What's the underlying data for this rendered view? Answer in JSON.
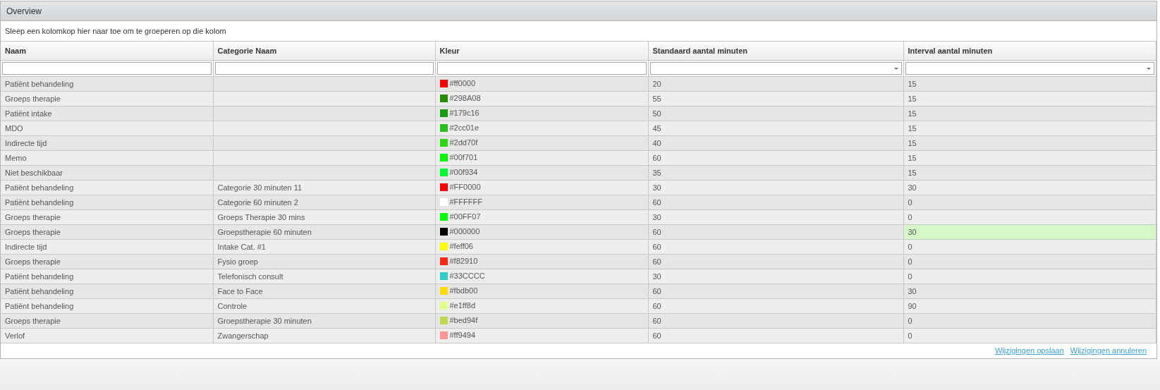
{
  "panel": {
    "title": "Overview"
  },
  "group_hint": "Sleep een kolomkop hier naar toe om te groeperen op die kolom",
  "table": {
    "columns": [
      {
        "label": "Naam",
        "kind": "text"
      },
      {
        "label": "Categorie Naam",
        "kind": "text"
      },
      {
        "label": "Kleur",
        "kind": "text"
      },
      {
        "label": "Standaard aantal minuten",
        "kind": "dropdown"
      },
      {
        "label": "Interval aantal minuten",
        "kind": "dropdown"
      }
    ],
    "rows": [
      {
        "name": "Patiënt behandeling",
        "category": "",
        "color": "#ff0000",
        "color_text": "#ff0000",
        "standard": "20",
        "interval": "15",
        "interval_changed": false
      },
      {
        "name": "Groeps therapie",
        "category": "",
        "color": "#298a08",
        "color_text": "#298A08",
        "standard": "55",
        "interval": "15",
        "interval_changed": false
      },
      {
        "name": "Patiënt intake",
        "category": "",
        "color": "#179c16",
        "color_text": "#179c16",
        "standard": "50",
        "interval": "15",
        "interval_changed": false
      },
      {
        "name": "MDO",
        "category": "",
        "color": "#2cc01e",
        "color_text": "#2cc01e",
        "standard": "45",
        "interval": "15",
        "interval_changed": false
      },
      {
        "name": "Indirecte tijd",
        "category": "",
        "color": "#2dd70f",
        "color_text": "#2dd70f",
        "standard": "40",
        "interval": "15",
        "interval_changed": false
      },
      {
        "name": "Memo",
        "category": "",
        "color": "#00f701",
        "color_text": "#00f701",
        "standard": "60",
        "interval": "15",
        "interval_changed": false
      },
      {
        "name": "Niet beschikbaar",
        "category": "",
        "color": "#00f934",
        "color_text": "#00f934",
        "standard": "35",
        "interval": "15",
        "interval_changed": false
      },
      {
        "name": "Patiënt behandeling",
        "category": "Categorie 30 minuten 11",
        "color": "#ff0000",
        "color_text": "#FF0000",
        "standard": "30",
        "interval": "30",
        "interval_changed": false
      },
      {
        "name": "Patiënt behandeling",
        "category": "Categorie 60 minuten 2",
        "color": "#ffffff",
        "color_text": "#FFFFFF",
        "standard": "60",
        "interval": "0",
        "interval_changed": false
      },
      {
        "name": "Groeps therapie",
        "category": "Groeps Therapie 30 mins",
        "color": "#00ff07",
        "color_text": "#00FF07",
        "standard": "30",
        "interval": "0",
        "interval_changed": false
      },
      {
        "name": "Groeps therapie",
        "category": "Groepstherapie 60 minuten",
        "color": "#000000",
        "color_text": "#000000",
        "standard": "60",
        "interval": "30",
        "interval_changed": true
      },
      {
        "name": "Indirecte tijd",
        "category": "Intake Cat. #1",
        "color": "#feff06",
        "color_text": "#feff06",
        "standard": "60",
        "interval": "0",
        "interval_changed": false
      },
      {
        "name": "Groeps therapie",
        "category": "Fysio groep",
        "color": "#f82910",
        "color_text": "#f82910",
        "standard": "60",
        "interval": "0",
        "interval_changed": false
      },
      {
        "name": "Patiënt behandeling",
        "category": "Telefonisch consult",
        "color": "#33cccc",
        "color_text": "#33CCCC",
        "standard": "30",
        "interval": "0",
        "interval_changed": false
      },
      {
        "name": "Patiënt behandeling",
        "category": "Face to Face",
        "color": "#fbdb00",
        "color_text": "#fbdb00",
        "standard": "60",
        "interval": "30",
        "interval_changed": false
      },
      {
        "name": "Patiënt behandeling",
        "category": "Controle",
        "color": "#e1ff8d",
        "color_text": "#e1ff8d",
        "standard": "60",
        "interval": "90",
        "interval_changed": false
      },
      {
        "name": "Groeps therapie",
        "category": "Groepstherapie 30 minuten",
        "color": "#bed94f",
        "color_text": "#bed94f",
        "standard": "60",
        "interval": "0",
        "interval_changed": false
      },
      {
        "name": "Verlof",
        "category": "Zwangerschap",
        "color": "#ff9494",
        "color_text": "#ff9494",
        "standard": "60",
        "interval": "0",
        "interval_changed": false
      }
    ]
  },
  "actions": [
    "Wijzigingen opslaan",
    "Wijzigingen annuleren"
  ]
}
